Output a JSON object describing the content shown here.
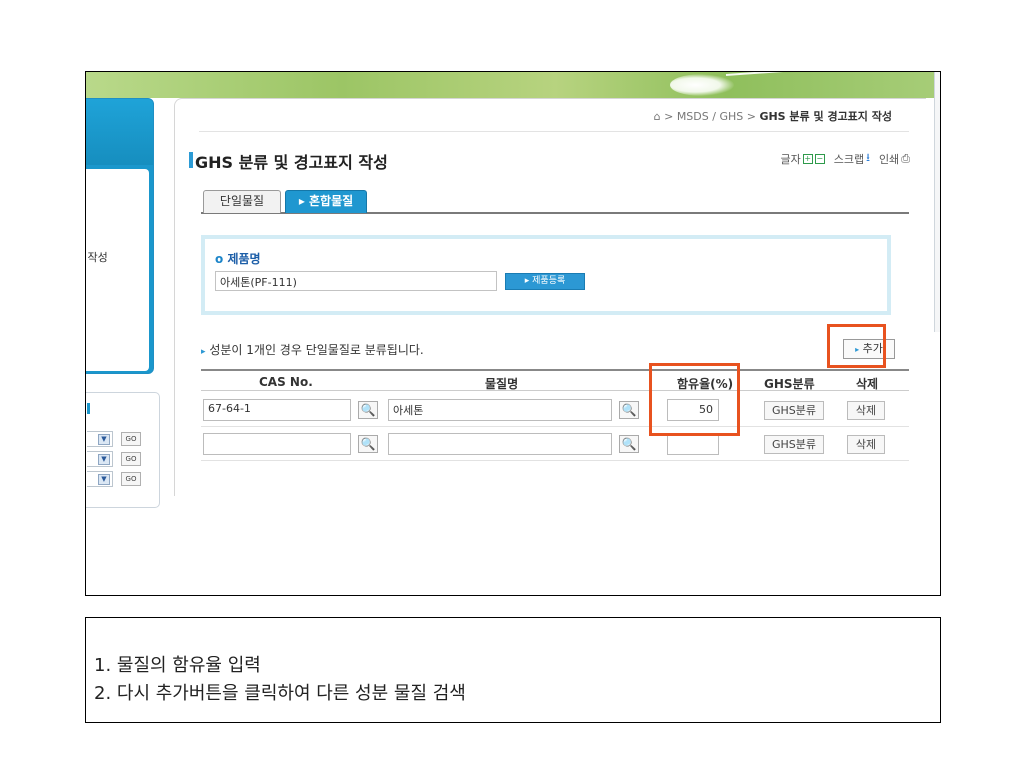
{
  "sidebar": {
    "menu_fragment": "l 작성",
    "go_label": "GO",
    "dropdown_arrow": "▼"
  },
  "breadcrumb": {
    "home_icon": "home-icon",
    "path": "⌂ > MSDS / GHS > ",
    "current": "GHS 분류 및 경고표지 작성"
  },
  "page": {
    "title": "GHS 분류 및 경고표지 작성"
  },
  "tools": {
    "font_label": "글자",
    "font_plus": "+",
    "font_minus": "−",
    "scrap_label": "스크랩",
    "scrap_icon": "⭳",
    "print_label": "인쇄",
    "print_icon": "⎙"
  },
  "tabs": [
    {
      "label": "단일물질",
      "active": false
    },
    {
      "label": "▸ 혼합물질",
      "active": true
    }
  ],
  "product": {
    "label_marker": "o",
    "label": "제품명",
    "value": "아세톤(PF-111)",
    "register_label": "▸ 제품등록"
  },
  "notice": {
    "marker": "▸",
    "text": " 성분이 1개인 경우 단일물질로 분류됩니다."
  },
  "add_button": {
    "marker": "▸",
    "label": "추가"
  },
  "table": {
    "headers": [
      "CAS No.",
      "물질명",
      "함유율(%)",
      "GHS분류",
      "삭제"
    ],
    "rows": [
      {
        "cas": "67-64-1",
        "name": "아세톤",
        "content": "50",
        "ghs": "GHS분류",
        "delete": "삭제"
      },
      {
        "cas": "",
        "name": "",
        "content": "",
        "ghs": "GHS분류",
        "delete": "삭제"
      }
    ],
    "search_icon": "🔍"
  },
  "highlight_color": "#e8521f",
  "accent_color": "#2c98d4",
  "instructions": {
    "line1": "1.  물질의 함유율 입력",
    "line2": "2.  다시 추가버튼을 클릭하여 다른 성분 물질 검색"
  }
}
